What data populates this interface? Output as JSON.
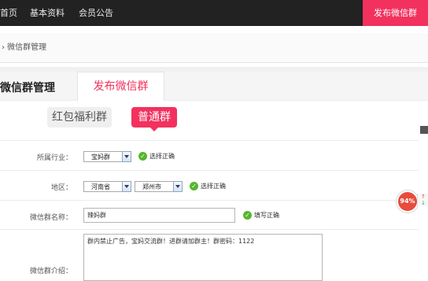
{
  "nav": {
    "items": [
      "首页",
      "基本资料",
      "会员公告"
    ],
    "publish_label": "发布微信群"
  },
  "breadcrumb": "› 微信群管理",
  "tabs": {
    "title": "微信群管理",
    "publish": "发布微信群"
  },
  "group_types": {
    "red_packet": "红包福利群",
    "normal": "普通群",
    "selected": "普通群"
  },
  "form": {
    "industry": {
      "label": "所属行业：",
      "value": "宝妈群",
      "status": "选择正确"
    },
    "region": {
      "label": "地区：",
      "province": "河南省",
      "city": "郑州市",
      "status": "选择正确"
    },
    "name": {
      "label": "微信群名称：",
      "value": "辣妈群",
      "status": "填写正确"
    },
    "intro": {
      "label": "微信群介绍：",
      "value": "群内禁止广告，宝妈交流群！进群请加群主！群密码：1122"
    }
  },
  "widgets": {
    "percent": "94%",
    "up_arrow": "↑",
    "down_arrow": "↓"
  },
  "colors": {
    "accent": "#f2315e",
    "nav_bg": "#222222",
    "success": "#57b52d"
  }
}
